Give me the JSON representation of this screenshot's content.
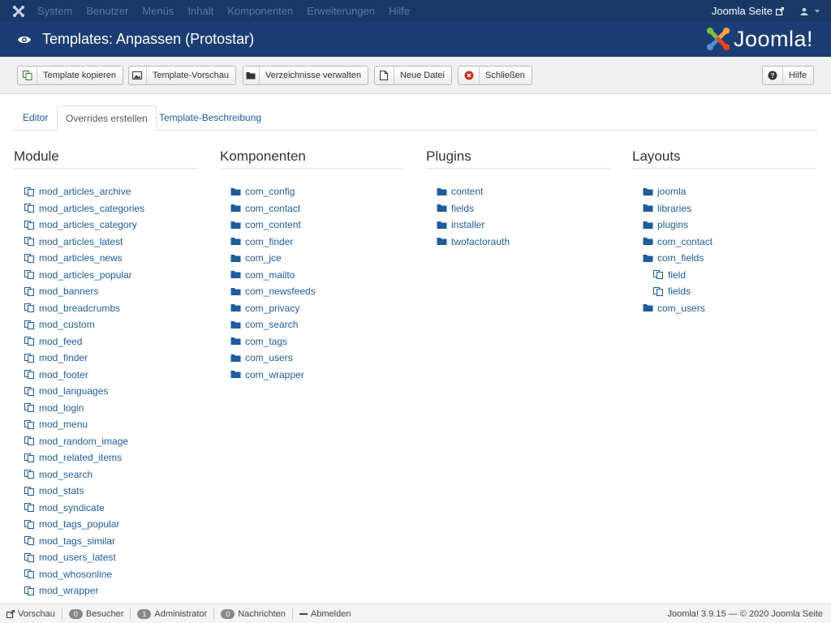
{
  "nav": {
    "items": [
      "System",
      "Benutzer",
      "Menüs",
      "Inhalt",
      "Komponenten",
      "Erweiterungen",
      "Hilfe"
    ],
    "site_link": "Joomla Seite"
  },
  "header": {
    "title": "Templates: Anpassen (Protostar)",
    "brand": "Joomla!"
  },
  "toolbar": {
    "copy": "Template kopieren",
    "preview": "Template-Vorschau",
    "folders": "Verzeichnisse verwalten",
    "new_file": "Neue Datei",
    "close": "Schließen",
    "help": "Hilfe"
  },
  "tabs": [
    "Editor",
    "Overrides erstellen",
    "Template-Beschreibung"
  ],
  "columns": {
    "module": {
      "title": "Module",
      "items": [
        "mod_articles_archive",
        "mod_articles_categories",
        "mod_articles_category",
        "mod_articles_latest",
        "mod_articles_news",
        "mod_articles_popular",
        "mod_banners",
        "mod_breadcrumbs",
        "mod_custom",
        "mod_feed",
        "mod_finder",
        "mod_footer",
        "mod_languages",
        "mod_login",
        "mod_menu",
        "mod_random_image",
        "mod_related_items",
        "mod_search",
        "mod_stats",
        "mod_syndicate",
        "mod_tags_popular",
        "mod_tags_similar",
        "mod_users_latest",
        "mod_whosonline",
        "mod_wrapper"
      ]
    },
    "komponenten": {
      "title": "Komponenten",
      "items": [
        "com_config",
        "com_contact",
        "com_content",
        "com_finder",
        "com_jce",
        "com_mailto",
        "com_newsfeeds",
        "com_privacy",
        "com_search",
        "com_tags",
        "com_users",
        "com_wrapper"
      ]
    },
    "plugins": {
      "title": "Plugins",
      "items": [
        "content",
        "fields",
        "installer",
        "twofactorauth"
      ]
    },
    "layouts": {
      "title": "Layouts",
      "items": [
        "joomla",
        "libraries",
        "plugins",
        "com_contact",
        "com_fields",
        "field",
        "fields",
        "com_users"
      ]
    }
  },
  "status": {
    "preview": "Vorschau",
    "visitors_count": "0",
    "visitors": "Besucher",
    "admins_count": "1",
    "admins": "Administrator",
    "messages_count": "0",
    "messages": "Nachrichten",
    "logout": "Abmelden",
    "footer": "Joomla! 3.9.15 — © 2020 Joomla Seite"
  },
  "colors": {
    "nav_bg": "#1a3867",
    "header_bg": "#1c3d73",
    "link": "#1f5c99"
  }
}
